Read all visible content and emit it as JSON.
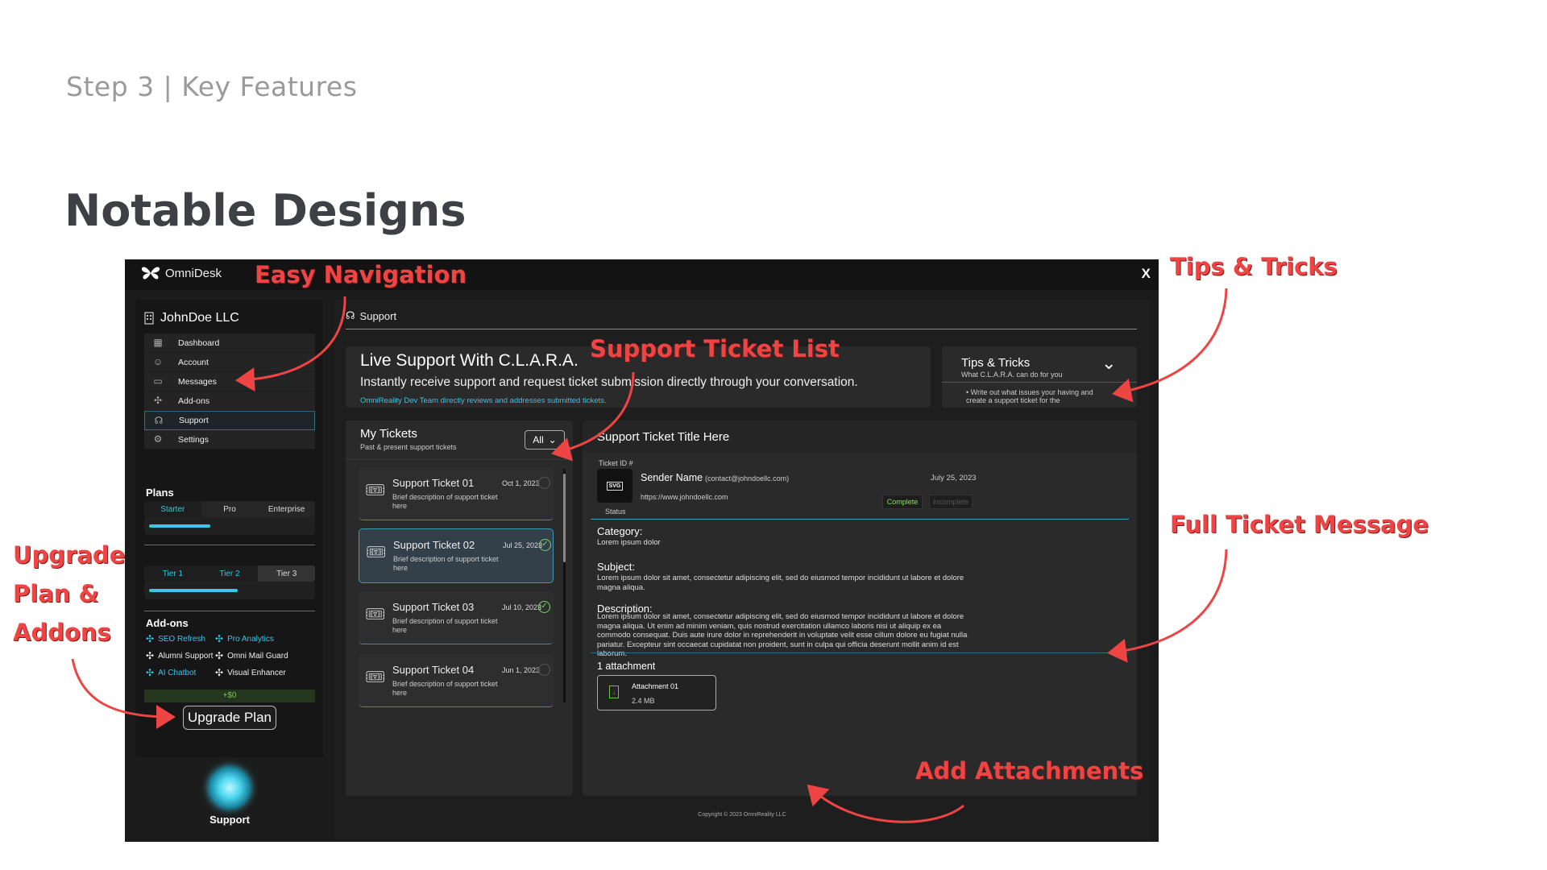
{
  "header": {
    "step": "Step 3 | Key Features",
    "title": "Notable Designs"
  },
  "app": {
    "name": "OmniDesk",
    "close": "X",
    "breadcrumb": "Support",
    "copyright": "Copyright © 2023 OmniReality LLC"
  },
  "sidebar": {
    "company": "JohnDoe LLC",
    "items": [
      {
        "label": "Dashboard",
        "icon": "grid-icon"
      },
      {
        "label": "Account",
        "icon": "user-icon"
      },
      {
        "label": "Messages",
        "icon": "messages-icon"
      },
      {
        "label": "Add-ons",
        "icon": "puzzle-icon"
      },
      {
        "label": "Support",
        "icon": "headset-icon"
      },
      {
        "label": "Settings",
        "icon": "gear-icon"
      }
    ],
    "plans_title": "Plans",
    "plans": [
      "Starter",
      "Pro",
      "Enterprise"
    ],
    "plans_progress": 0.38,
    "tiers": [
      "Tier 1",
      "Tier 2",
      "Tier 3"
    ],
    "tiers_progress": 0.55,
    "addons_title": "Add-ons",
    "addons": [
      {
        "label": "SEO Refresh",
        "active": true
      },
      {
        "label": "Pro Analytics",
        "active": true
      },
      {
        "label": "Alumni Support",
        "active": false
      },
      {
        "label": "Omni Mail Guard",
        "active": false
      },
      {
        "label": "AI Chatbot",
        "active": true
      },
      {
        "label": "Visual Enhancer",
        "active": false
      }
    ],
    "price": "+$0",
    "upgrade": "Upgrade Plan",
    "support_label": "Support"
  },
  "live": {
    "title": "Live Support With C.L.A.R.A.",
    "subtitle": "Instantly receive support and request ticket submission directly through your conversation.",
    "note": "OmniReality Dev Team directly reviews and addresses submitted tickets."
  },
  "tips": {
    "title": "Tips & Tricks",
    "subtitle": "What C.L.A.R.A. can do for you",
    "item": "Write out what issues your having and create a support ticket for the"
  },
  "tickets": {
    "title": "My Tickets",
    "subtitle": "Past & present support tickets",
    "filter": "All",
    "list": [
      {
        "title": "Support Ticket 01",
        "date": "Oct 1, 2023",
        "desc": "Brief description of support ticket here",
        "done": false
      },
      {
        "title": "Support Ticket 02",
        "date": "Jul 25, 2023",
        "desc": "Brief description of support ticket here",
        "done": true
      },
      {
        "title": "Support Ticket 03",
        "date": "Jul 10, 2023",
        "desc": "Brief description of support ticket here",
        "done": true
      },
      {
        "title": "Support Ticket 04",
        "date": "Jun 1, 2023",
        "desc": "Brief description of support ticket here",
        "done": false
      }
    ]
  },
  "detail": {
    "title": "Support Ticket Title Here",
    "ticket_id": "Ticket ID #",
    "file_badge": "SVG",
    "sender": "Sender Name",
    "email": "(contact@johndoellc.com)",
    "date": "July 25, 2023",
    "url": "https://www.johndoellc.com",
    "status_label": "Status",
    "complete": "Complete",
    "incomplete": "Incomplete",
    "category_label": "Category:",
    "category": "Lorem ipsum dolor",
    "subject_label": "Subject:",
    "subject": "Lorem ipsum dolor sit amet, consectetur adipiscing elit, sed do eiusmod tempor incididunt ut labore et dolore magna aliqua.",
    "description_label": "Description:",
    "description": "Lorem ipsum dolor sit amet, consectetur adipiscing elit, sed do eiusmod tempor incididunt ut labore et dolore magna aliqua. Ut enim ad minim veniam, quis nostrud exercitation ullamco laboris nisi ut aliquip ex ea commodo consequat. Duis aute irure dolor in reprehenderit in voluptate velit esse cillum dolore eu fugiat nulla pariatur. Excepteur sint occaecat cupidatat non proident, sunt in culpa qui officia deserunt mollit anim id est laborum.",
    "attach_count": "1 attachment",
    "attach_name": "Attachment 01",
    "attach_size": "2.4 MB"
  },
  "annotations": {
    "nav": "Easy Navigation",
    "tips": "Tips & Tricks",
    "list": "Support Ticket List",
    "full": "Full Ticket Message",
    "upgrade1": "Upgrade",
    "upgrade2": "Plan &",
    "upgrade3": "Addons",
    "attach": "Add Attachments"
  }
}
